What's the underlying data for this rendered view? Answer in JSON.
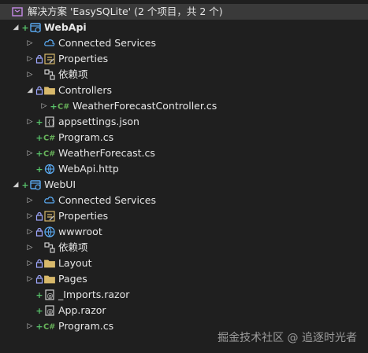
{
  "solution_label": "解决方案 'EasySQLite' (2 个项目，共 2 个)",
  "watermark": "掘金技术社区 @ 追逐时光者",
  "colors": {
    "background": "#1f1f1f",
    "selected_row": "#3a3a3a",
    "added_status": "#57c26a",
    "lock_status": "#9fa8ff",
    "csharp": "#68b35a",
    "folder": "#d7b86b"
  },
  "tree": [
    {
      "id": "webapi",
      "label": "WebApi",
      "indent": 0,
      "arrow": "down",
      "status": "plus",
      "icon": "project-icon",
      "bold": true
    },
    {
      "id": "connected-services-1",
      "label": "Connected Services",
      "indent": 1,
      "arrow": "right",
      "status": "",
      "icon": "cloud-icon"
    },
    {
      "id": "properties-1",
      "label": "Properties",
      "indent": 1,
      "arrow": "right",
      "status": "lock",
      "icon": "properties-icon"
    },
    {
      "id": "dependencies-1",
      "label": "依赖项",
      "indent": 1,
      "arrow": "right",
      "status": "",
      "icon": "dependencies-icon"
    },
    {
      "id": "controllers",
      "label": "Controllers",
      "indent": 1,
      "arrow": "down",
      "status": "lock",
      "icon": "folder-icon"
    },
    {
      "id": "weatherforecastcontroller",
      "label": "WeatherForecastController.cs",
      "indent": 2,
      "arrow": "right",
      "status": "plus",
      "icon": "csharp-icon"
    },
    {
      "id": "appsettings",
      "label": "appsettings.json",
      "indent": 1,
      "arrow": "right",
      "status": "plus",
      "icon": "json-icon"
    },
    {
      "id": "program-1",
      "label": "Program.cs",
      "indent": 1,
      "arrow": "",
      "status": "plus",
      "icon": "csharp-icon"
    },
    {
      "id": "weatherforecast",
      "label": "WeatherForecast.cs",
      "indent": 1,
      "arrow": "right",
      "status": "plus",
      "icon": "csharp-icon"
    },
    {
      "id": "webapi-http",
      "label": "WebApi.http",
      "indent": 1,
      "arrow": "",
      "status": "plus",
      "icon": "http-icon"
    },
    {
      "id": "webui",
      "label": "WebUI",
      "indent": 0,
      "arrow": "down",
      "status": "plus",
      "icon": "project-icon"
    },
    {
      "id": "connected-services-2",
      "label": "Connected Services",
      "indent": 1,
      "arrow": "right",
      "status": "",
      "icon": "cloud-icon"
    },
    {
      "id": "properties-2",
      "label": "Properties",
      "indent": 1,
      "arrow": "right",
      "status": "lock",
      "icon": "properties-icon"
    },
    {
      "id": "wwwroot",
      "label": "wwwroot",
      "indent": 1,
      "arrow": "right",
      "status": "lock",
      "icon": "globe-icon"
    },
    {
      "id": "dependencies-2",
      "label": "依赖项",
      "indent": 1,
      "arrow": "right",
      "status": "",
      "icon": "dependencies-icon"
    },
    {
      "id": "layout",
      "label": "Layout",
      "indent": 1,
      "arrow": "right",
      "status": "lock",
      "icon": "folder-icon"
    },
    {
      "id": "pages",
      "label": "Pages",
      "indent": 1,
      "arrow": "right",
      "status": "lock",
      "icon": "folder-icon"
    },
    {
      "id": "imports-razor",
      "label": "_Imports.razor",
      "indent": 1,
      "arrow": "",
      "status": "plus",
      "icon": "razor-icon"
    },
    {
      "id": "app-razor",
      "label": "App.razor",
      "indent": 1,
      "arrow": "",
      "status": "plus",
      "icon": "razor-icon"
    },
    {
      "id": "program-2",
      "label": "Program.cs",
      "indent": 1,
      "arrow": "right",
      "status": "plus",
      "icon": "csharp-icon"
    }
  ]
}
